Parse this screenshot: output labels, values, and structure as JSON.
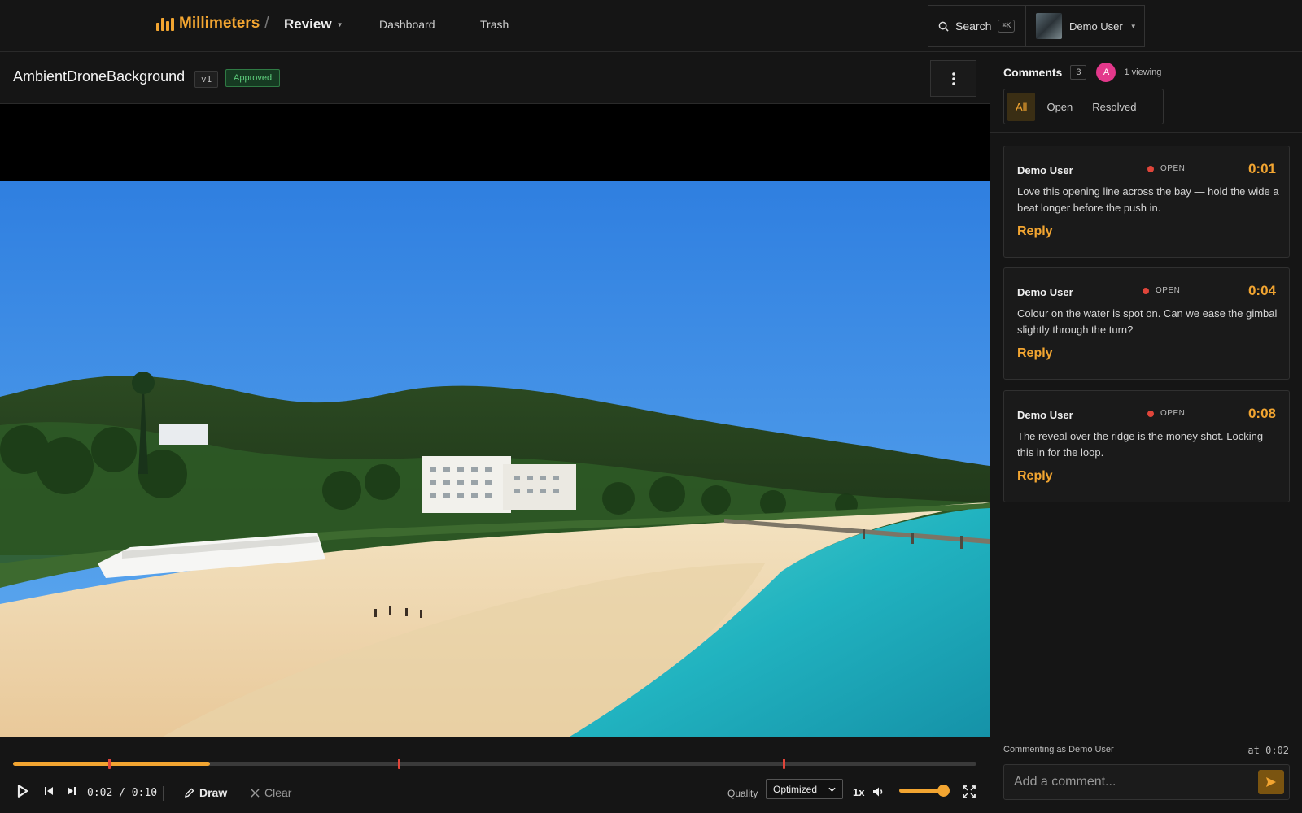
{
  "app": {
    "name": "Millimeters",
    "section": "Review"
  },
  "nav": {
    "dashboard": "Dashboard",
    "trash": "Trash"
  },
  "search": {
    "label": "Search",
    "shortcut": "⌘K"
  },
  "user": {
    "name": "Demo User"
  },
  "asset": {
    "title": "AmbientDroneBackground",
    "version": "v1",
    "status": "Approved"
  },
  "player": {
    "current_time": "0:02",
    "duration": "0:10",
    "timecode": "0:02 / 0:10",
    "progress": 0.204,
    "comment_marker_times": [
      0.1,
      0.4,
      0.8
    ],
    "draw_label": "Draw",
    "clear_label": "Clear",
    "quality_label": "Quality",
    "quality_value": "Optimized",
    "speed": "1x",
    "volume": 0.9
  },
  "comments_panel": {
    "title": "Comments",
    "count": "3",
    "viewer_initial": "A",
    "viewing_text": "1 viewing",
    "tabs": [
      "All",
      "Open",
      "Resolved"
    ],
    "active_tab": "All",
    "items": [
      {
        "author": "Demo User",
        "status": "OPEN",
        "time": "0:01",
        "body": "Love this opening line across the bay — hold the wide a beat longer before the push in.",
        "reply": "Reply"
      },
      {
        "author": "Demo User",
        "status": "OPEN",
        "time": "0:04",
        "body": "Colour on the water is spot on. Can we ease the gimbal slightly through the turn?",
        "reply": "Reply"
      },
      {
        "author": "Demo User",
        "status": "OPEN",
        "time": "0:08",
        "body": "The reveal over the ridge is the money shot. Locking this in for the loop.",
        "reply": "Reply"
      }
    ],
    "commenting_as": "Commenting as Demo User",
    "at_time": "at 0:02",
    "placeholder": "Add a comment..."
  },
  "colors": {
    "accent": "#f2a531",
    "open_dot": "#e0453a",
    "approved": "#5fce7d",
    "avatar": "#e3388b"
  }
}
